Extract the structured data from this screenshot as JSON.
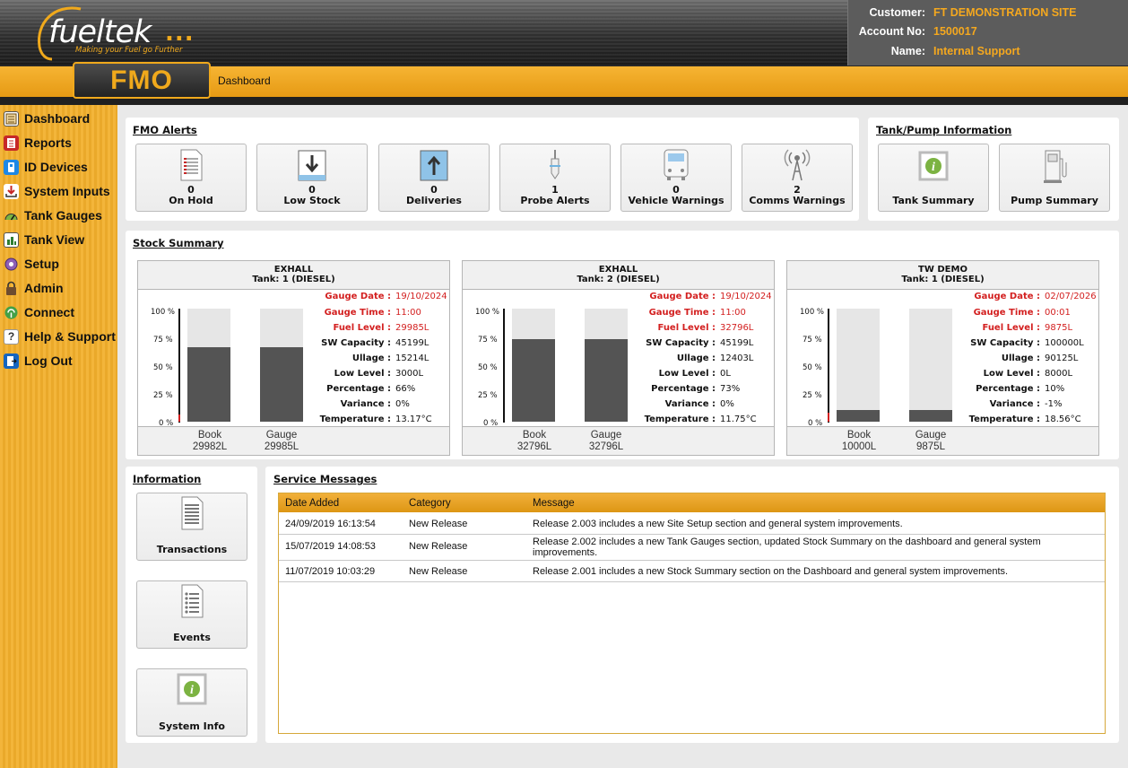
{
  "header": {
    "logo_text": "fueltek",
    "logo_dots": "...",
    "logo_tagline": "Making your Fuel go Further",
    "app_badge": "FMO",
    "breadcrumb": "Dashboard",
    "customer": {
      "customer_label": "Customer:",
      "customer_value": "FT DEMONSTRATION SITE",
      "account_label": "Account No:",
      "account_value": "1500017",
      "name_label": "Name:",
      "name_value": "Internal Support"
    }
  },
  "sidebar": {
    "items": [
      {
        "label": "Dashboard",
        "icon": "dashboard-icon"
      },
      {
        "label": "Reports",
        "icon": "reports-icon"
      },
      {
        "label": "ID Devices",
        "icon": "id-devices-icon"
      },
      {
        "label": "System Inputs",
        "icon": "system-inputs-icon"
      },
      {
        "label": "Tank Gauges",
        "icon": "tank-gauges-icon"
      },
      {
        "label": "Tank View",
        "icon": "tank-view-icon"
      },
      {
        "label": "Setup",
        "icon": "setup-icon"
      },
      {
        "label": "Admin",
        "icon": "admin-icon"
      },
      {
        "label": "Connect",
        "icon": "connect-icon"
      },
      {
        "label": "Help & Support",
        "icon": "help-icon"
      },
      {
        "label": "Log Out",
        "icon": "logout-icon"
      }
    ]
  },
  "alerts": {
    "title": "FMO Alerts",
    "tiles": [
      {
        "count": "0",
        "label": "On Hold",
        "icon": "on-hold-icon"
      },
      {
        "count": "0",
        "label": "Low Stock",
        "icon": "low-stock-icon"
      },
      {
        "count": "0",
        "label": "Deliveries",
        "icon": "deliveries-icon"
      },
      {
        "count": "1",
        "label": "Probe Alerts",
        "icon": "probe-icon"
      },
      {
        "count": "0",
        "label": "Vehicle Warnings",
        "icon": "vehicle-icon"
      },
      {
        "count": "2",
        "label": "Comms Warnings",
        "icon": "comms-icon"
      }
    ]
  },
  "tank_pump": {
    "title": "Tank/Pump Information",
    "tiles": [
      {
        "label": "Tank Summary",
        "icon": "tank-summary-icon"
      },
      {
        "label": "Pump Summary",
        "icon": "pump-icon"
      }
    ]
  },
  "stock": {
    "title": "Stock Summary",
    "y_ticks": [
      "100 %",
      "75 %",
      "50 %",
      "25 %",
      "0 %"
    ],
    "labels": {
      "gauge_date": "Gauge Date :",
      "gauge_time": "Gauge Time :",
      "fuel_level": "Fuel Level :",
      "sw_capacity": "SW Capacity :",
      "ullage": "Ullage :",
      "low_level": "Low Level :",
      "percentage": "Percentage :",
      "variance": "Variance :",
      "temperature": "Temperature :"
    },
    "tanks": [
      {
        "site": "EXHALL",
        "tank": "Tank: 1 (DIESEL)",
        "gauge_date": "19/10/2024",
        "gauge_time": "11:00",
        "fuel_level": "29985L",
        "sw_capacity": "45199L",
        "ullage": "15214L",
        "low_level": "3000L",
        "percentage": "66%",
        "variance": "0%",
        "temperature": "13.17°C",
        "book_label": "Book",
        "book_value": "29982L",
        "gauge_label": "Gauge",
        "gauge_value": "29985L",
        "book_pct": 66,
        "gauge_pct": 66,
        "low_pct": 6.6
      },
      {
        "site": "EXHALL",
        "tank": "Tank: 2 (DIESEL)",
        "gauge_date": "19/10/2024",
        "gauge_time": "11:00",
        "fuel_level": "32796L",
        "sw_capacity": "45199L",
        "ullage": "12403L",
        "low_level": "0L",
        "percentage": "73%",
        "variance": "0%",
        "temperature": "11.75°C",
        "book_label": "Book",
        "book_value": "32796L",
        "gauge_label": "Gauge",
        "gauge_value": "32796L",
        "book_pct": 73,
        "gauge_pct": 73,
        "low_pct": 0
      },
      {
        "site": "TW DEMO",
        "tank": "Tank: 1 (DIESEL)",
        "gauge_date": "02/07/2026",
        "gauge_time": "00:01",
        "fuel_level": "9875L",
        "sw_capacity": "100000L",
        "ullage": "90125L",
        "low_level": "8000L",
        "percentage": "10%",
        "variance": "-1%",
        "temperature": "18.56°C",
        "book_label": "Book",
        "book_value": "10000L",
        "gauge_label": "Gauge",
        "gauge_value": "9875L",
        "book_pct": 10,
        "gauge_pct": 10,
        "low_pct": 8
      }
    ]
  },
  "information": {
    "title": "Information",
    "tiles": [
      {
        "label": "Transactions",
        "icon": "transactions-icon"
      },
      {
        "label": "Events",
        "icon": "events-icon"
      },
      {
        "label": "System Info",
        "icon": "system-info-icon"
      }
    ]
  },
  "service": {
    "title": "Service Messages",
    "columns": [
      "Date Added",
      "Category",
      "Message"
    ],
    "rows": [
      {
        "date": "24/09/2019 16:13:54",
        "category": "New Release",
        "message": "Release 2.003 includes a new Site Setup section and general system improvements."
      },
      {
        "date": "15/07/2019 14:08:53",
        "category": "New Release",
        "message": "Release 2.002 includes a new Tank Gauges section, updated Stock Summary on the dashboard and general system improvements."
      },
      {
        "date": "11/07/2019 10:03:29",
        "category": "New Release",
        "message": "Release 2.001 includes a new Stock Summary section on the Dashboard and general system improvements."
      }
    ]
  },
  "colors": {
    "accent": "#f0a91c",
    "alert_red": "#d32020",
    "bar_fill": "#545454"
  }
}
